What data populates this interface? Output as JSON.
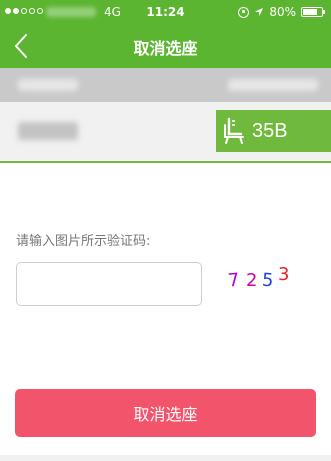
{
  "status_bar": {
    "signal_dots": 5,
    "signal_filled": 2,
    "network": "4G",
    "time": "11:24",
    "battery": "80%",
    "battery_level": 0.8,
    "icons": [
      "lock-rotation-icon",
      "location-arrow-icon",
      "battery-icon"
    ]
  },
  "nav": {
    "back_icon": "chevron-left-icon",
    "title": "取消选座"
  },
  "seat": {
    "icon": "seat-icon",
    "label": "35B"
  },
  "form": {
    "prompt": "请输入图片所示验证码:",
    "input_value": "",
    "captcha_chars": [
      "7",
      "2",
      "5",
      "3"
    ],
    "captcha_colors": [
      "#b000d9",
      "#d000a8",
      "#1f3fd8",
      "#e1242f"
    ]
  },
  "actions": {
    "cancel_label": "取消选座"
  },
  "colors": {
    "brand_green": "#5cb531",
    "seat_green": "#6fba3c",
    "cancel_red": "#f1546b"
  }
}
